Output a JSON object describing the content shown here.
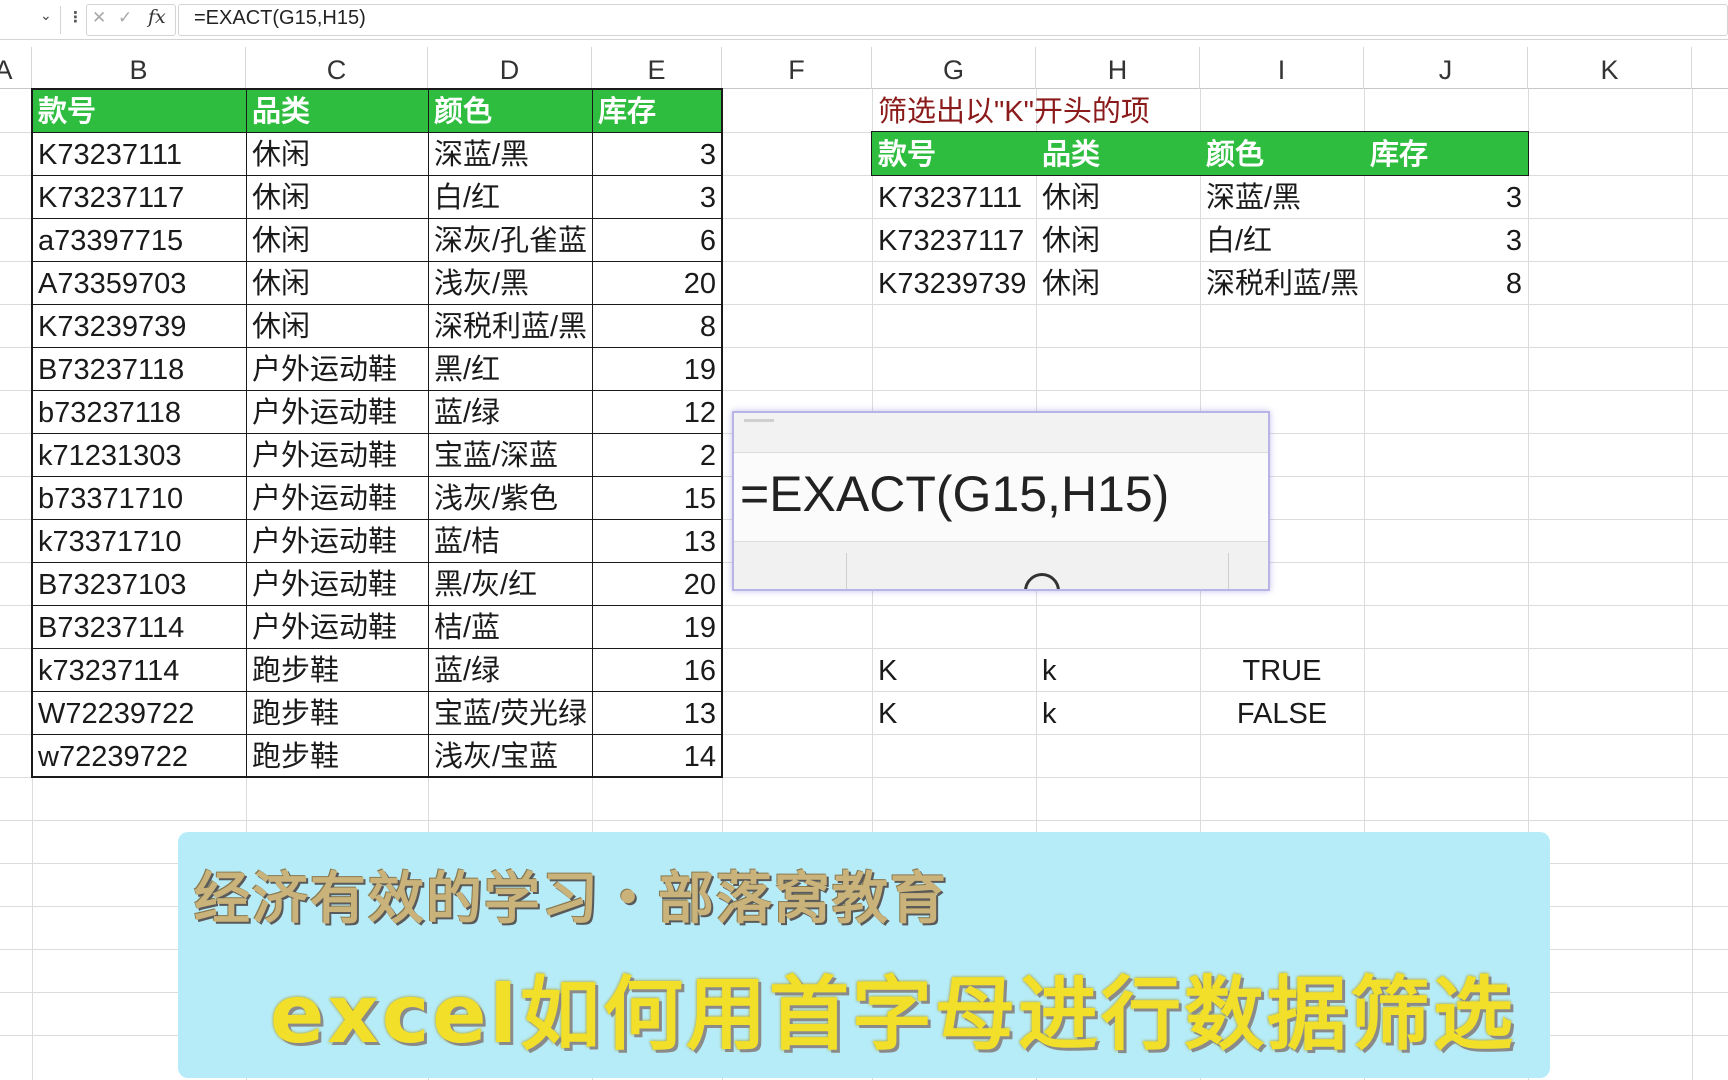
{
  "formula_bar": {
    "formula": "=EXACT(G15,H15)",
    "fx_label": "fx"
  },
  "columns": [
    "A",
    "B",
    "C",
    "D",
    "E",
    "F",
    "G",
    "H",
    "I",
    "J",
    "K"
  ],
  "left_table": {
    "headers": [
      "款号",
      "品类",
      "颜色",
      "库存"
    ],
    "rows": [
      [
        "K73237111",
        "休闲",
        "深蓝/黑",
        "3"
      ],
      [
        "K73237117",
        "休闲",
        "白/红",
        "3"
      ],
      [
        "a73397715",
        "休闲",
        "深灰/孔雀蓝",
        "6"
      ],
      [
        "A73359703",
        "休闲",
        "浅灰/黑",
        "20"
      ],
      [
        "K73239739",
        "休闲",
        "深税利蓝/黑",
        "8"
      ],
      [
        "B73237118",
        "户外运动鞋",
        "黑/红",
        "19"
      ],
      [
        "b73237118",
        "户外运动鞋",
        "蓝/绿",
        "12"
      ],
      [
        "k71231303",
        "户外运动鞋",
        "宝蓝/深蓝",
        "2"
      ],
      [
        "b73371710",
        "户外运动鞋",
        "浅灰/紫色",
        "15"
      ],
      [
        "k73371710",
        "户外运动鞋",
        "蓝/桔",
        "13"
      ],
      [
        "B73237103",
        "户外运动鞋",
        "黑/灰/红",
        "20"
      ],
      [
        "B73237114",
        "户外运动鞋",
        "桔/蓝",
        "19"
      ],
      [
        "k73237114",
        "跑步鞋",
        "蓝/绿",
        "16"
      ],
      [
        "W72239722",
        "跑步鞋",
        "宝蓝/荧光绿",
        "13"
      ],
      [
        "w72239722",
        "跑步鞋",
        "浅灰/宝蓝",
        "14"
      ]
    ]
  },
  "right_table": {
    "title": "筛选出以\"K\"开头的项",
    "headers": [
      "款号",
      "品类",
      "颜色",
      "库存"
    ],
    "rows": [
      [
        "K73237111",
        "休闲",
        "深蓝/黑",
        "3"
      ],
      [
        "K73237117",
        "休闲",
        "白/红",
        "3"
      ],
      [
        "K73239739",
        "休闲",
        "深税利蓝/黑",
        "8"
      ]
    ]
  },
  "exact_rows": [
    [
      "K",
      "k",
      "TRUE"
    ],
    [
      "K",
      "k",
      "FALSE"
    ]
  ],
  "zoom": {
    "formula": "=EXACT(G15,H15)"
  },
  "banner": {
    "subtitle": "经济有效的学习・部落窝教育",
    "title": "excel如何用首字母进行数据筛选"
  },
  "colors": {
    "header_green": "#2ebd3f",
    "title_red": "#8b1a1a",
    "banner_bg": "#b6ecf8"
  }
}
